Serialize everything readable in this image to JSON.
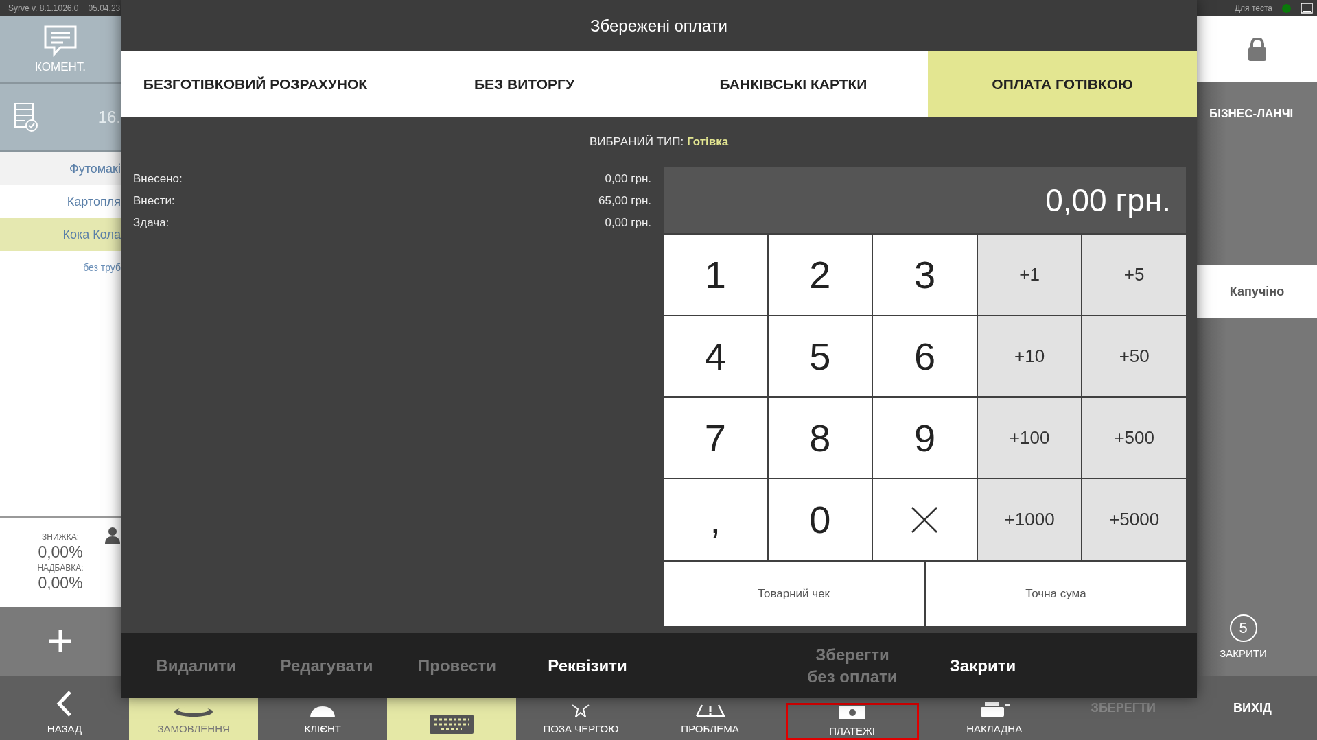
{
  "status_bar": {
    "version": "Syrve  v. 8.1.1026.0",
    "date": "05.04.23",
    "terminal": "Для теста",
    "online": true
  },
  "left_panel": {
    "comment_button": "КОМЕНТ.",
    "order_time": "16.",
    "items": [
      {
        "name": "Футомакі",
        "selected": false
      },
      {
        "name": "Картопля",
        "selected": false
      },
      {
        "name": "Кока Кола",
        "selected": true
      }
    ],
    "modifier": "без труб",
    "discount_label": "ЗНИЖКА:",
    "discount_value": "0,00%",
    "markup_label": "НАДБАВКА:",
    "markup_value": "0,00%"
  },
  "right_panel": {
    "category": "БІЗНЕС-ЛАНЧІ",
    "product": "Капучіно",
    "close_count": "5",
    "close_label": "ЗАКРИТИ"
  },
  "bottom_nav": [
    {
      "kind": "back",
      "label": "НАЗАД",
      "selected": false,
      "disabled": false,
      "highlighted": false
    },
    {
      "kind": "order",
      "label": "ЗАМОВЛЕННЯ",
      "selected": true,
      "disabled": false,
      "highlighted": false
    },
    {
      "kind": "client",
      "label": "КЛІЄНТ",
      "selected": false,
      "disabled": false,
      "highlighted": false
    },
    {
      "kind": "keyboard",
      "selected": true,
      "disabled": false,
      "highlighted": false
    },
    {
      "kind": "priority",
      "label": "ПОЗА ЧЕРГОЮ",
      "selected": false,
      "disabled": false,
      "highlighted": false
    },
    {
      "kind": "problem",
      "label": "ПРОБЛЕМА",
      "selected": false,
      "disabled": false,
      "highlighted": false
    },
    {
      "kind": "payments",
      "label": "ПЛАТЕЖІ",
      "selected": false,
      "disabled": false,
      "highlighted": true
    },
    {
      "kind": "invoice",
      "label": "НАКЛАДНА",
      "selected": false,
      "disabled": false,
      "highlighted": false
    },
    {
      "kind": "text",
      "label": "ЗБЕРЕГТИ",
      "selected": false,
      "disabled": true,
      "highlighted": false
    },
    {
      "kind": "text",
      "label": "ВИХІД",
      "selected": false,
      "disabled": false,
      "highlighted": false
    }
  ],
  "dialog": {
    "title": "Збережені оплати",
    "tabs": [
      {
        "label": "БЕЗГОТІВКОВИЙ РОЗРАХУНОК",
        "selected": false
      },
      {
        "label": "БЕЗ ВИТОРГУ",
        "selected": false
      },
      {
        "label": "БАНКІВСЬКІ КАРТКИ",
        "selected": false
      },
      {
        "label": "ОПЛАТА ГОТІВКОЮ",
        "selected": true
      }
    ],
    "selected_type_label": "ВИБРАНИЙ ТИП:",
    "selected_type": "Готівка",
    "summary": [
      {
        "label": "Внесено:",
        "value": "0,00 грн."
      },
      {
        "label": "Внести:",
        "value": "65,00 грн."
      },
      {
        "label": "Здача:",
        "value": "0,00 грн."
      }
    ],
    "display": "0,00 грн.",
    "keys": [
      {
        "kind": "digit",
        "label": "1"
      },
      {
        "kind": "digit",
        "label": "2"
      },
      {
        "kind": "digit",
        "label": "3"
      },
      {
        "kind": "quick",
        "label": "+1"
      },
      {
        "kind": "quick",
        "label": "+5"
      },
      {
        "kind": "digit",
        "label": "4"
      },
      {
        "kind": "digit",
        "label": "5"
      },
      {
        "kind": "digit",
        "label": "6"
      },
      {
        "kind": "quick",
        "label": "+10"
      },
      {
        "kind": "quick",
        "label": "+50"
      },
      {
        "kind": "digit",
        "label": "7"
      },
      {
        "kind": "digit",
        "label": "8"
      },
      {
        "kind": "digit",
        "label": "9"
      },
      {
        "kind": "quick",
        "label": "+100"
      },
      {
        "kind": "quick",
        "label": "+500"
      },
      {
        "kind": "digit",
        "label": ","
      },
      {
        "kind": "digit",
        "label": "0"
      },
      {
        "kind": "clear"
      },
      {
        "kind": "quick",
        "label": "+1000"
      },
      {
        "kind": "quick",
        "label": "+5000"
      }
    ],
    "extra_buttons": [
      "Товарний чек",
      "Точна сума"
    ],
    "actions": [
      {
        "label": "Видалити",
        "disabled": true
      },
      {
        "label": "Редагувати",
        "disabled": true
      },
      {
        "label": "Провести",
        "disabled": true
      },
      {
        "label": "Реквізити",
        "disabled": false
      },
      {
        "label": "Зберегти\nбез оплати",
        "disabled": true
      },
      {
        "label": "Закрити",
        "disabled": false
      }
    ]
  }
}
